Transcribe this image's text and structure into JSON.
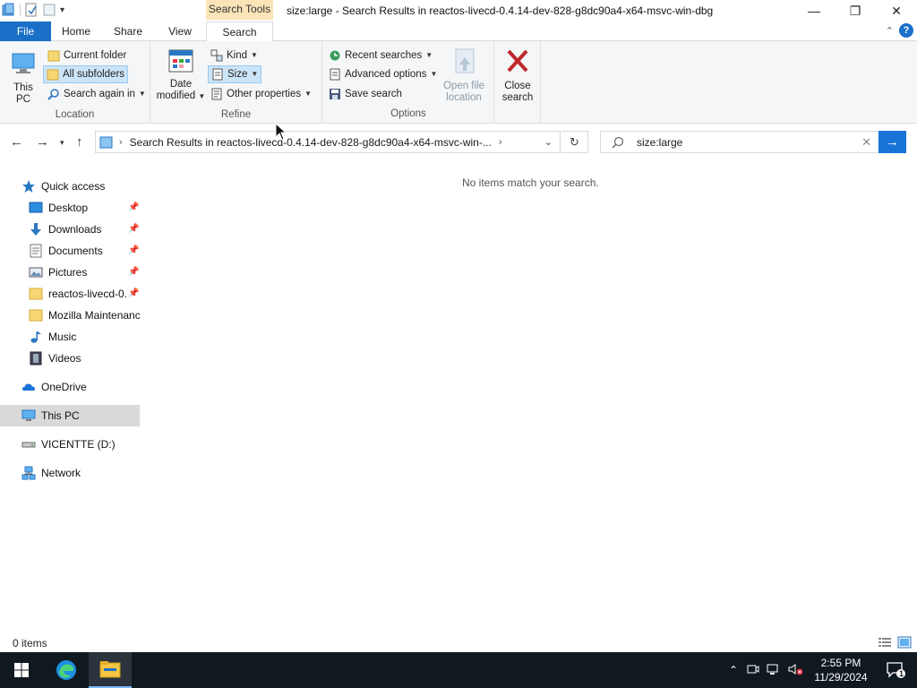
{
  "window": {
    "title": "size:large - Search Results in reactos-livecd-0.4.14-dev-828-g8dc90a4-x64-msvc-win-dbg",
    "context_tab": "Search Tools",
    "minimize": "—",
    "maximize": "❐",
    "close": "✕"
  },
  "tabs": [
    "File",
    "Home",
    "Share",
    "View",
    "Search"
  ],
  "ribbon": {
    "location": {
      "label": "Location",
      "this_pc": "This PC",
      "current_folder": "Current folder",
      "all_subfolders": "All subfolders",
      "search_again_in": "Search again in"
    },
    "refine": {
      "label": "Refine",
      "date_modified_line1": "Date",
      "date_modified_line2": "modified",
      "kind": "Kind",
      "size": "Size",
      "other_properties": "Other properties"
    },
    "options": {
      "label": "Options",
      "recent_searches": "Recent searches",
      "advanced_options": "Advanced options",
      "save_search": "Save search",
      "open_file_location_line1": "Open file",
      "open_file_location_line2": "location",
      "close_search_line1": "Close",
      "close_search_line2": "search"
    }
  },
  "address": {
    "path": "Search Results in reactos-livecd-0.4.14-dev-828-g8dc90a4-x64-msvc-win-...",
    "search_value": "size:large"
  },
  "sidebar": {
    "quick_access": "Quick access",
    "items": [
      {
        "label": "Desktop",
        "pinned": true
      },
      {
        "label": "Downloads",
        "pinned": true
      },
      {
        "label": "Documents",
        "pinned": true
      },
      {
        "label": "Pictures",
        "pinned": true
      },
      {
        "label": "reactos-livecd-0.",
        "pinned": true
      },
      {
        "label": "Mozilla Maintenanc",
        "pinned": false
      },
      {
        "label": "Music",
        "pinned": false
      },
      {
        "label": "Videos",
        "pinned": false
      }
    ],
    "onedrive": "OneDrive",
    "this_pc": "This PC",
    "drive": "VICENTTE (D:)",
    "network": "Network"
  },
  "content": {
    "empty_message": "No items match your search."
  },
  "status": {
    "item_count": "0 items"
  },
  "taskbar": {
    "time": "2:55 PM",
    "date": "11/29/2024",
    "notification_count": "1"
  },
  "colors": {
    "accent": "#1a6fc7",
    "context_tab": "#fbe4b8",
    "taskbar": "#101820",
    "selected": "#cce4f7"
  }
}
